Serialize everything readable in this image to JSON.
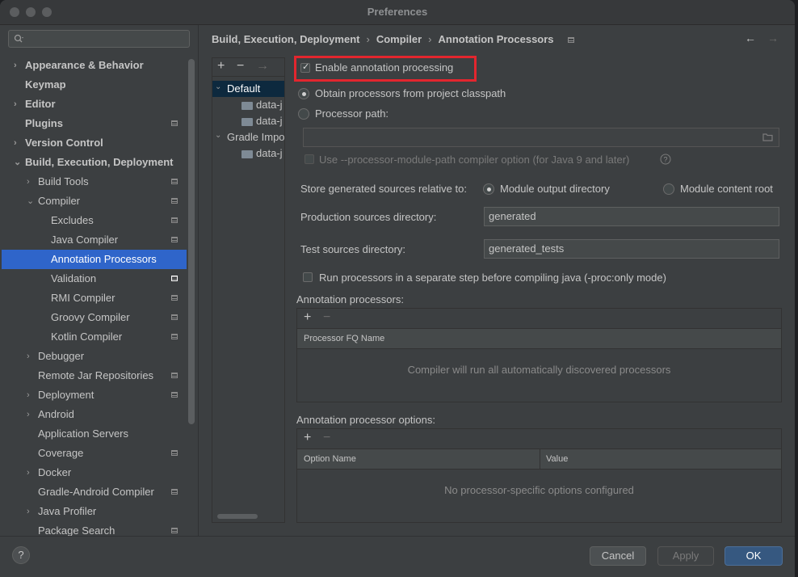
{
  "window": {
    "title": "Preferences"
  },
  "search": {
    "placeholder": ""
  },
  "sidebar": {
    "items": [
      {
        "label": "Appearance & Behavior"
      },
      {
        "label": "Keymap"
      },
      {
        "label": "Editor"
      },
      {
        "label": "Plugins"
      },
      {
        "label": "Version Control"
      },
      {
        "label": "Build, Execution, Deployment"
      },
      {
        "label": "Build Tools"
      },
      {
        "label": "Compiler"
      },
      {
        "label": "Excludes"
      },
      {
        "label": "Java Compiler"
      },
      {
        "label": "Annotation Processors"
      },
      {
        "label": "Validation"
      },
      {
        "label": "RMI Compiler"
      },
      {
        "label": "Groovy Compiler"
      },
      {
        "label": "Kotlin Compiler"
      },
      {
        "label": "Debugger"
      },
      {
        "label": "Remote Jar Repositories"
      },
      {
        "label": "Deployment"
      },
      {
        "label": "Android"
      },
      {
        "label": "Application Servers"
      },
      {
        "label": "Coverage"
      },
      {
        "label": "Docker"
      },
      {
        "label": "Gradle-Android Compiler"
      },
      {
        "label": "Java Profiler"
      },
      {
        "label": "Package Search"
      }
    ]
  },
  "breadcrumb": {
    "part1": "Build, Execution, Deployment",
    "part2": "Compiler",
    "part3": "Annotation Processors",
    "sep": "›",
    "back": "←",
    "forward": "→"
  },
  "profiles": {
    "add": "+",
    "remove": "−",
    "move": "→",
    "rows": [
      {
        "label": "Default"
      },
      {
        "label": "data-j"
      },
      {
        "label": "data-j"
      },
      {
        "label": "Gradle Impo"
      },
      {
        "label": "data-j"
      }
    ]
  },
  "settings": {
    "enable_label": "Enable annotation processing",
    "obtain_label": "Obtain processors from project classpath",
    "path_label": "Processor path:",
    "path_value": "",
    "module_path_label": "Use --processor-module-path compiler option (for Java 9 and later)",
    "store_label": "Store generated sources relative to:",
    "module_output": "Module output directory",
    "module_content": "Module content root",
    "prod_label": "Production sources directory:",
    "prod_value": "generated",
    "test_label": "Test sources directory:",
    "test_value": "generated_tests",
    "separate_label": "Run processors in a separate step before compiling java (-proc:only mode)"
  },
  "processors": {
    "title": "Annotation processors:",
    "add": "+",
    "remove": "−",
    "col_name": "Processor FQ Name",
    "empty": "Compiler will run all automatically discovered processors"
  },
  "options": {
    "title": "Annotation processor options:",
    "add": "+",
    "remove": "−",
    "col_name": "Option Name",
    "col_value": "Value",
    "empty": "No processor-specific options configured"
  },
  "footer": {
    "help": "?",
    "cancel": "Cancel",
    "apply": "Apply",
    "ok": "OK"
  }
}
